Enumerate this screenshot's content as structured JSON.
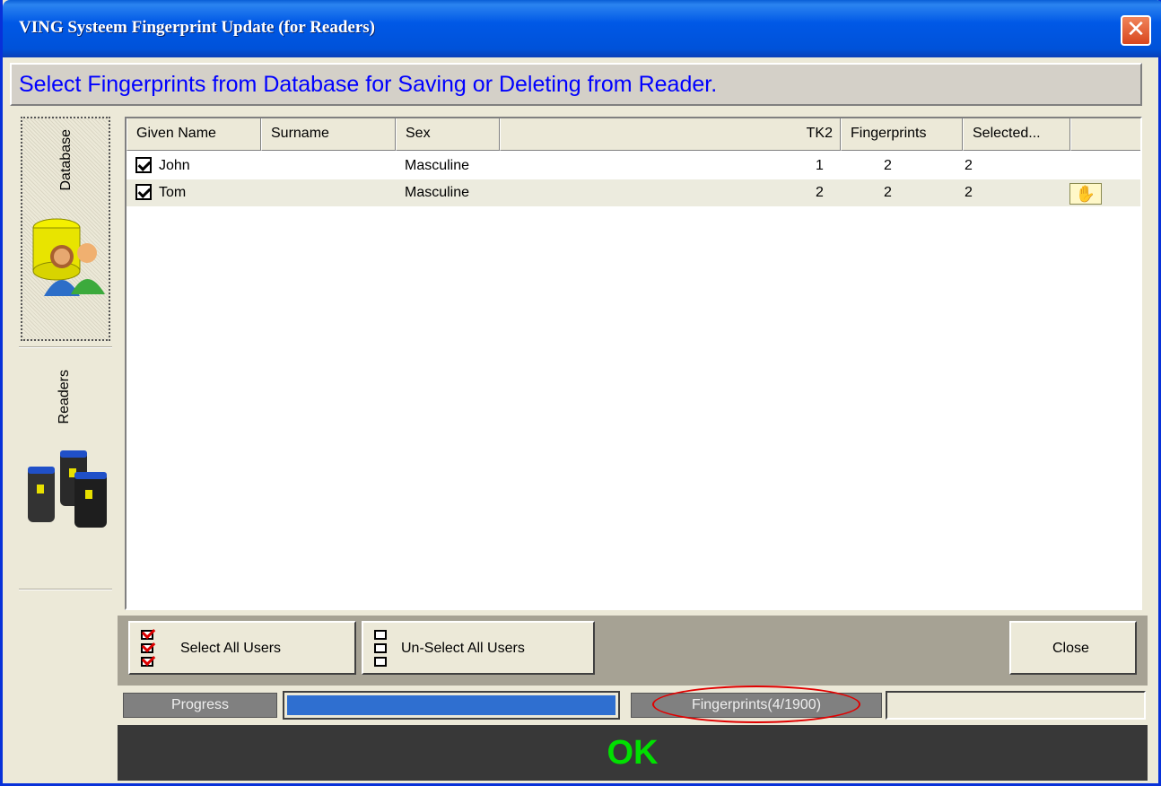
{
  "window": {
    "title": "VING Systeem Fingerprint Update (for Readers)",
    "close_glyph": "✕"
  },
  "instruction": "Select Fingerprints from Database for Saving or Deleting from Reader.",
  "sidebar": {
    "tabs": [
      {
        "label": "Database",
        "icon": "database-users-icon",
        "active": true
      },
      {
        "label": "Readers",
        "icon": "fingerprint-readers-icon",
        "active": false
      }
    ]
  },
  "grid": {
    "columns": [
      "Given Name",
      "Surname",
      "Sex",
      "TK2",
      "Fingerprints",
      "Selected..."
    ],
    "rows": [
      {
        "checked": true,
        "given_name": "John",
        "surname": "",
        "sex": "Masculine",
        "tk2": "1",
        "fingerprints": "2",
        "selected": "2",
        "has_icon": false
      },
      {
        "checked": true,
        "given_name": "Tom",
        "surname": "",
        "sex": "Masculine",
        "tk2": "2",
        "fingerprints": "2",
        "selected": "2",
        "has_icon": true,
        "icon": "hand-fingerprint-icon"
      }
    ]
  },
  "buttons": {
    "select_all": "Select All Users",
    "unselect_all": "Un-Select All Users",
    "close": "Close"
  },
  "progress": {
    "label": "Progress",
    "fingerprints_label": "Fingerprints(4/1900)",
    "fill_fraction": 1.0
  },
  "status": "OK",
  "colors": {
    "title_bar": "#0054e3",
    "instruction_text": "#0000ff",
    "status_text": "#00e000",
    "progress_fill": "#2f6fd0",
    "highlight_oval": "#e00000"
  }
}
